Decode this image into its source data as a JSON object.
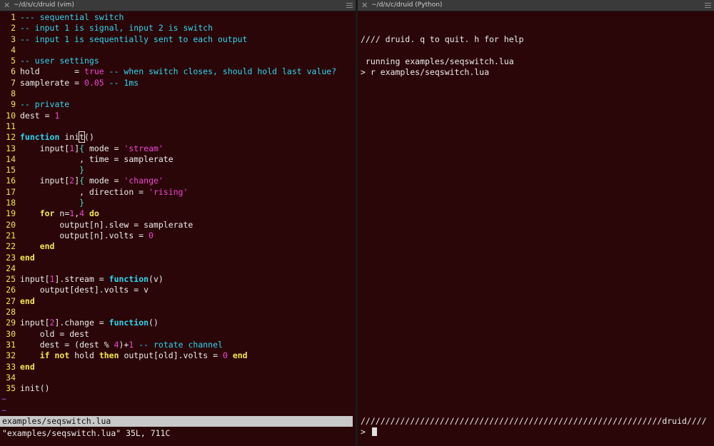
{
  "left_pane": {
    "title": "~/d/s/c/druid (vim)",
    "status_bar": "examples/seqswitch.lua",
    "message": "\"examples/seqswitch.lua\" 35L, 711C",
    "lines": [
      {
        "num": "1",
        "text": "--- sequential switch"
      },
      {
        "num": "2",
        "text": "-- input 1 is signal, input 2 is switch"
      },
      {
        "num": "3",
        "text": "-- input 1 is sequentially sent to each output"
      },
      {
        "num": "4",
        "text": ""
      },
      {
        "num": "5",
        "text": "-- user settings"
      },
      {
        "num": "6",
        "text": "hold       = true -- when switch closes, should hold last value?"
      },
      {
        "num": "7",
        "text": "samplerate = 0.05 -- 1ms"
      },
      {
        "num": "8",
        "text": ""
      },
      {
        "num": "9",
        "text": "-- private"
      },
      {
        "num": "10",
        "text": "dest = 1"
      },
      {
        "num": "11",
        "text": ""
      },
      {
        "num": "12",
        "text": "function init()"
      },
      {
        "num": "13",
        "text": "    input[1]{ mode = 'stream'"
      },
      {
        "num": "14",
        "text": "            , time = samplerate"
      },
      {
        "num": "15",
        "text": "            }"
      },
      {
        "num": "16",
        "text": "    input[2]{ mode = 'change'"
      },
      {
        "num": "17",
        "text": "            , direction = 'rising'"
      },
      {
        "num": "18",
        "text": "            }"
      },
      {
        "num": "19",
        "text": "    for n=1,4 do"
      },
      {
        "num": "20",
        "text": "        output[n].slew = samplerate"
      },
      {
        "num": "21",
        "text": "        output[n].volts = 0"
      },
      {
        "num": "22",
        "text": "    end"
      },
      {
        "num": "23",
        "text": "end"
      },
      {
        "num": "24",
        "text": ""
      },
      {
        "num": "25",
        "text": "input[1].stream = function(v)"
      },
      {
        "num": "26",
        "text": "    output[dest].volts = v"
      },
      {
        "num": "27",
        "text": "end"
      },
      {
        "num": "28",
        "text": ""
      },
      {
        "num": "29",
        "text": "input[2].change = function()"
      },
      {
        "num": "30",
        "text": "    old = dest"
      },
      {
        "num": "31",
        "text": "    dest = (dest % 4)+1 -- rotate channel"
      },
      {
        "num": "32",
        "text": "    if not hold then output[old].volts = 0 end"
      },
      {
        "num": "33",
        "text": "end"
      },
      {
        "num": "34",
        "text": ""
      },
      {
        "num": "35",
        "text": "init()"
      }
    ],
    "tildes": [
      "~",
      "~"
    ]
  },
  "right_pane": {
    "title": "~/d/s/c/druid (Python)",
    "banner": "//// druid. q to quit. h for help",
    "running": " running examples/seqswitch.lua",
    "command": "> r examples/seqswitch.lua",
    "divider": "/////////////////////////////////////////////////////////////druid////",
    "prompt": "> "
  },
  "colors": {
    "background": "#2a0608",
    "line_numbers": "#f5e84a",
    "comments": "#2fd6f0",
    "strings": "#f046d6",
    "keywords": "#f5e84a"
  }
}
